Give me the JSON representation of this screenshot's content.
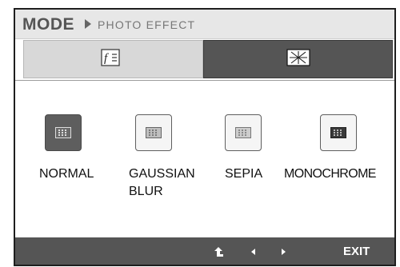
{
  "header": {
    "mode_label": "MODE",
    "page_name": "PHOTO EFFECT"
  },
  "tabs": [
    {
      "icon": "picture-settings-icon",
      "active": true
    },
    {
      "icon": "special-effect-icon",
      "active": false
    }
  ],
  "options": [
    {
      "label": "NORMAL",
      "icon": "normal-effect-icon",
      "selected": true
    },
    {
      "label": "GAUSSIAN BLUR",
      "icon": "gaussian-blur-effect-icon",
      "selected": false
    },
    {
      "label": "SEPIA",
      "icon": "sepia-effect-icon",
      "selected": false
    },
    {
      "label": "MONOCHROME",
      "icon": "monochrome-effect-icon",
      "selected": false
    }
  ],
  "footer": {
    "buttons": [
      "back-icon",
      "left-arrow-icon",
      "right-arrow-icon"
    ],
    "exit_label": "EXIT"
  },
  "colors": {
    "header_bg": "#e7e7e7",
    "bottom_bar_bg": "#555555",
    "selected_icon_bg": "#5e5e5e"
  }
}
